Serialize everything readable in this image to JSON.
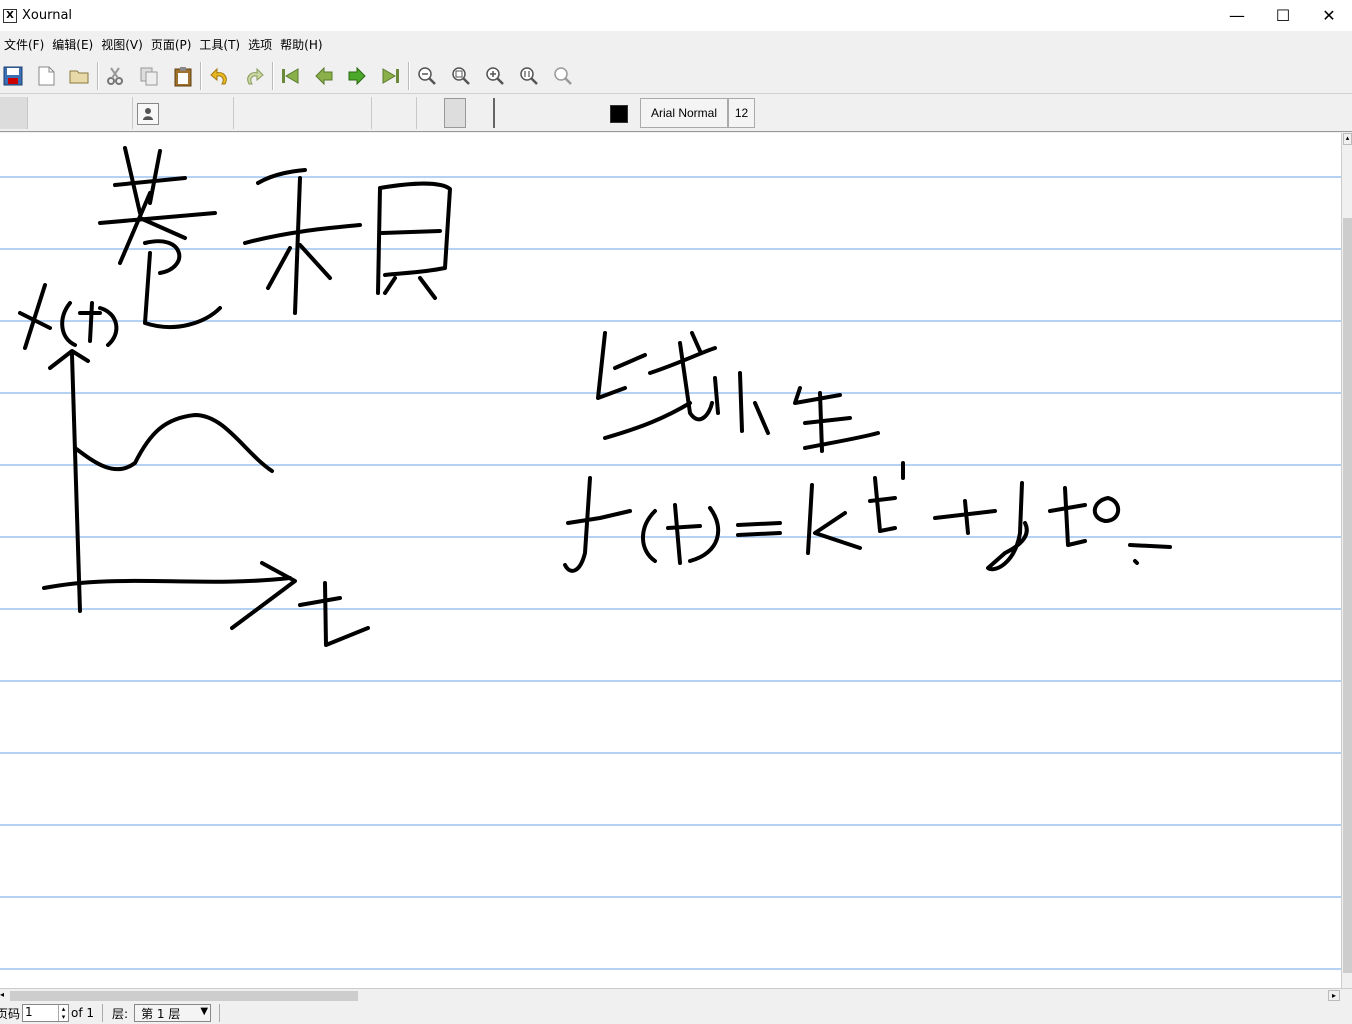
{
  "window": {
    "title": "Xournal",
    "minimize": "—",
    "maximize": "☐",
    "close": "✕"
  },
  "menu": [
    "文件(F)",
    "编辑(E)",
    "视图(V)",
    "页面(P)",
    "工具(T)",
    "选项",
    "帮助(H)"
  ],
  "toolbar": {
    "icons": [
      "save-icon",
      "new-page-icon",
      "open-icon",
      "cut-icon",
      "copy-icon",
      "paste-icon",
      "undo-icon",
      "redo-icon",
      "first-page-icon",
      "prev-page-icon",
      "next-page-icon",
      "last-page-icon",
      "zoom-out-icon",
      "zoom-fit-icon",
      "zoom-in-icon",
      "zoom-100-icon",
      "zoom-set-icon"
    ]
  },
  "toolbar2": {
    "font_name": "Arial Normal",
    "font_size": "12",
    "pen_color": "#000000"
  },
  "canvas": {
    "rule_color": "#9ec4ef",
    "ink_color": "#000000"
  },
  "statusbar": {
    "page_label": "页码",
    "page_value": "1",
    "page_total": "of 1",
    "layer_label": "层:",
    "layer_value": "第 1 层"
  }
}
